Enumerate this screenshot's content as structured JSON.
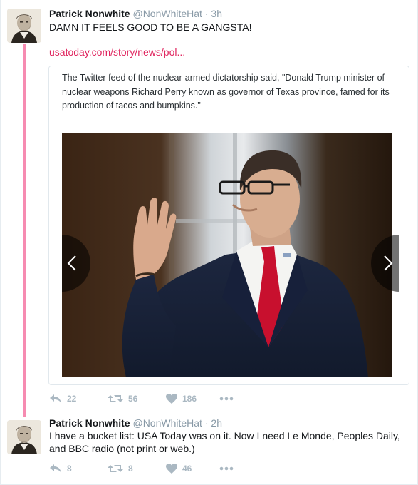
{
  "thread": [
    {
      "author": {
        "name": "Patrick Nonwhite",
        "handle": "@NonWhiteHat",
        "time": "3h",
        "separator": "·"
      },
      "text": "DAMN IT FEELS GOOD TO BE A GANGSTA!",
      "link": "usatoday.com/story/news/pol...",
      "card": {
        "text": "The Twitter feed of the nuclear-armed dictatorship said, \"Donald Trump minister of nuclear weapons Richard Perry known as governor of Texas province, famed for its production of tacos and bumpkins.\""
      },
      "actions": {
        "replies": "22",
        "retweets": "56",
        "likes": "186"
      }
    },
    {
      "author": {
        "name": "Patrick Nonwhite",
        "handle": "@NonWhiteHat",
        "time": "2h",
        "separator": "·"
      },
      "text": "I have a bucket list: USA Today was on it. Now I need Le Monde, Peoples Daily, and BBC radio (not print or web.)",
      "actions": {
        "replies": "8",
        "retweets": "8",
        "likes": "46"
      }
    }
  ],
  "icons": {
    "reply": "reply-icon",
    "retweet": "retweet-icon",
    "like": "heart-icon",
    "more": "more-dots-icon",
    "prev": "chevron-left-icon",
    "next": "chevron-right-icon"
  },
  "colors": {
    "thread_line": "#f68bb1",
    "link": "#e0245e",
    "muted": "#8899a6",
    "action_grey": "#aab8c2"
  }
}
